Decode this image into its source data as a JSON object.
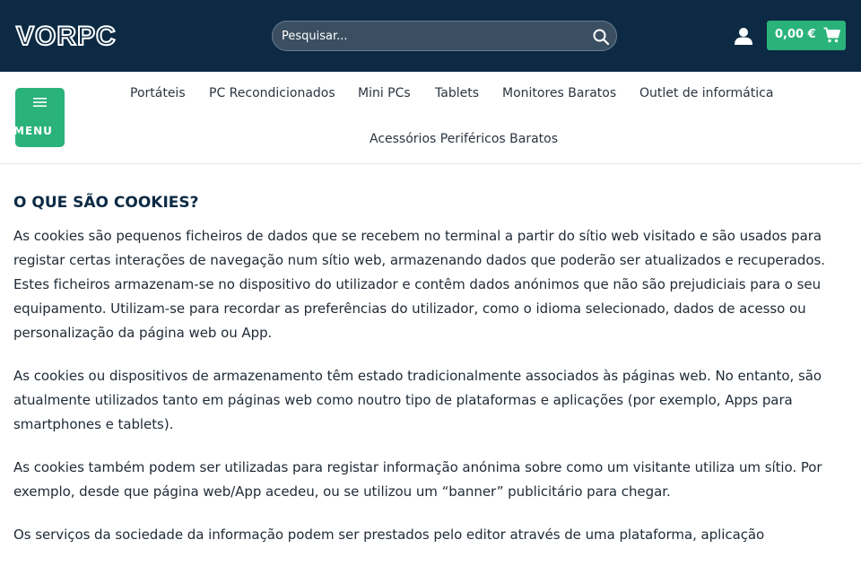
{
  "header": {
    "logo_text": "VORPC",
    "search": {
      "placeholder": "Pesquisar..."
    },
    "account_icon": "user-icon",
    "cart": {
      "total": "0,00 €",
      "icon": "cart-icon"
    }
  },
  "nav": {
    "menu_label": "MENU",
    "items": [
      "Portáteis",
      "PC Recondicionados",
      "Mini PCs",
      "Tablets",
      "Monitores Baratos",
      "Outlet de informática",
      "Acessórios Periféricos Baratos"
    ]
  },
  "content": {
    "title": "O QUE SÃO COOKIES?",
    "paragraphs": [
      "As cookies são pequenos ficheiros de dados que se recebem no terminal a partir do sítio web visitado e são usados para registar certas interações de navegação num sítio web, armazenando dados que poderão ser atualizados e recuperados. Estes ficheiros armazenam-se no dispositivo do utilizador e contêm dados anónimos que não são prejudiciais para o seu equipamento. Utilizam-se para recordar as preferências do utilizador, como o idioma selecionado, dados de acesso ou personalização da página web ou App.",
      "As cookies ou dispositivos de armazenamento têm estado tradicionalmente associados às páginas web. No entanto, são atualmente utilizados tanto em páginas web como noutro tipo de plataformas e aplicações (por exemplo, Apps para smartphones e tablets).",
      "As cookies também podem ser utilizadas para registar informação anónima sobre como um visitante utiliza um sítio. Por exemplo, desde que página web/App acedeu, ou se utilizou um “banner” publicitário para chegar.",
      "Os serviços da sociedade da informação podem ser prestados pelo editor através de uma plataforma, aplicação"
    ]
  },
  "colors": {
    "header_bg": "#0c2a44",
    "accent": "#2ab27b",
    "title": "#0c2a44"
  }
}
